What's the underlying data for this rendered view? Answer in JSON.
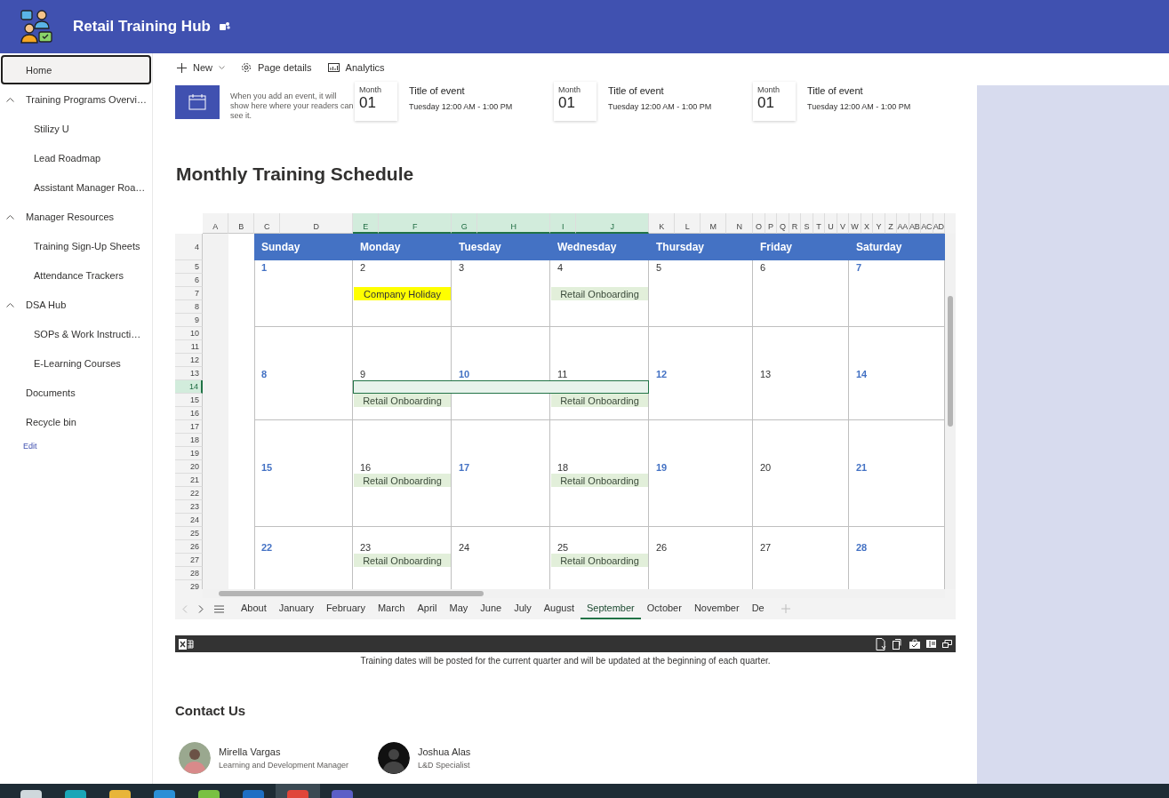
{
  "header": {
    "title": "Retail Training Hub"
  },
  "nav": {
    "items": [
      {
        "label": "Home",
        "selected": true
      },
      {
        "label": "Training Programs Overvi…",
        "selected": false,
        "expanded": true,
        "children": [
          {
            "label": "Stilizy U",
            "selected": false
          },
          {
            "label": "Lead Roadmap",
            "selected": false
          },
          {
            "label": "Assistant Manager Roa…",
            "selected": false
          }
        ]
      },
      {
        "label": "Manager Resources",
        "selected": false,
        "expanded": true,
        "children": [
          {
            "label": "Training Sign-Up Sheets",
            "selected": false
          },
          {
            "label": "Attendance Trackers",
            "selected": false
          }
        ]
      },
      {
        "label": "DSA Hub",
        "selected": false,
        "expanded": true,
        "children": [
          {
            "label": "SOPs & Work Instructi…",
            "selected": false
          },
          {
            "label": "E-Learning Courses",
            "selected": false
          }
        ]
      },
      {
        "label": "Documents",
        "selected": false
      },
      {
        "label": "Recycle bin",
        "selected": false
      }
    ],
    "edit_link": "Edit"
  },
  "command_bar": [
    {
      "label": "New",
      "dropdown": true
    },
    {
      "label": "Page details",
      "dropdown": false
    },
    {
      "label": "Analytics",
      "dropdown": false
    }
  ],
  "events": {
    "empty_text": "When you add an event, it will show here where your readers can see it.",
    "items": [
      {
        "month": "Month",
        "day": "01",
        "title": "Title of event",
        "time": "Tuesday 12:00 AM - 1:00 PM"
      },
      {
        "month": "Month",
        "day": "01",
        "title": "Title of event",
        "time": "Tuesday 12:00 AM - 1:00 PM"
      },
      {
        "month": "Month",
        "day": "01",
        "title": "Title of event",
        "time": "Tuesday 12:00 AM - 1:00 PM"
      }
    ]
  },
  "heading": "Monthly Training Schedule",
  "sheet": {
    "columns": [
      {
        "label": "A",
        "selected": false
      },
      {
        "label": "B",
        "selected": false
      },
      {
        "label": "C",
        "selected": false
      },
      {
        "label": "D",
        "selected": false
      },
      {
        "label": "E",
        "selected": true
      },
      {
        "label": "F",
        "selected": true
      },
      {
        "label": "G",
        "selected": true
      },
      {
        "label": "H",
        "selected": true
      },
      {
        "label": "I",
        "selected": true
      },
      {
        "label": "J",
        "selected": true
      },
      {
        "label": "K",
        "selected": false
      },
      {
        "label": "L",
        "selected": false
      },
      {
        "label": "M",
        "selected": false
      },
      {
        "label": "N",
        "selected": false
      },
      {
        "label": "O",
        "selected": false
      },
      {
        "label": "P",
        "selected": false
      },
      {
        "label": "Q",
        "selected": false
      },
      {
        "label": "R",
        "selected": false
      },
      {
        "label": "S",
        "selected": false
      },
      {
        "label": "T",
        "selected": false
      },
      {
        "label": "U",
        "selected": false
      },
      {
        "label": "V",
        "selected": false
      },
      {
        "label": "W",
        "selected": false
      },
      {
        "label": "X",
        "selected": false
      },
      {
        "label": "Y",
        "selected": false
      },
      {
        "label": "Z",
        "selected": false
      },
      {
        "label": "AA",
        "selected": false
      },
      {
        "label": "AB",
        "selected": false
      },
      {
        "label": "AC",
        "selected": false
      },
      {
        "label": "AD",
        "selected": false
      }
    ],
    "rows": [
      {
        "label": "4",
        "selected": false
      },
      {
        "label": "5",
        "selected": false
      },
      {
        "label": "6",
        "selected": false
      },
      {
        "label": "7",
        "selected": false
      },
      {
        "label": "8",
        "selected": false
      },
      {
        "label": "9",
        "selected": false
      },
      {
        "label": "10",
        "selected": false
      },
      {
        "label": "11",
        "selected": false
      },
      {
        "label": "12",
        "selected": false
      },
      {
        "label": "13",
        "selected": false
      },
      {
        "label": "14",
        "selected": true
      },
      {
        "label": "15",
        "selected": false
      },
      {
        "label": "16",
        "selected": false
      },
      {
        "label": "17",
        "selected": false
      },
      {
        "label": "18",
        "selected": false
      },
      {
        "label": "19",
        "selected": false
      },
      {
        "label": "20",
        "selected": false
      },
      {
        "label": "21",
        "selected": false
      },
      {
        "label": "22",
        "selected": false
      },
      {
        "label": "23",
        "selected": false
      },
      {
        "label": "24",
        "selected": false
      },
      {
        "label": "25",
        "selected": false
      },
      {
        "label": "26",
        "selected": false
      },
      {
        "label": "27",
        "selected": false
      },
      {
        "label": "28",
        "selected": false
      },
      {
        "label": "29",
        "selected": false
      }
    ],
    "weekdays": [
      "Sunday",
      "Monday",
      "Tuesday",
      "Wednesday",
      "Thursday",
      "Friday",
      "Saturday"
    ],
    "weeks": [
      {
        "days": [
          {
            "date": "1",
            "accent": true
          },
          {
            "date": "2",
            "accent": false,
            "events": [
              {
                "title": "Company Holiday",
                "kind": "holiday"
              }
            ]
          },
          {
            "date": "3",
            "accent": false
          },
          {
            "date": "4",
            "accent": false,
            "events": [
              {
                "title": "Retail Onboarding",
                "kind": "training"
              }
            ]
          },
          {
            "date": "5",
            "accent": false
          },
          {
            "date": "6",
            "accent": false
          },
          {
            "date": "7",
            "accent": true
          }
        ]
      },
      {
        "days": [
          {
            "date": "8",
            "accent": true
          },
          {
            "date": "9",
            "accent": false,
            "events": [
              {
                "title": "Retail Onboarding",
                "kind": "training"
              }
            ]
          },
          {
            "date": "10",
            "accent": true
          },
          {
            "date": "11",
            "accent": false,
            "events": [
              {
                "title": "Retail Onboarding",
                "kind": "training"
              }
            ]
          },
          {
            "date": "12",
            "accent": true
          },
          {
            "date": "13",
            "accent": false
          },
          {
            "date": "14",
            "accent": true
          }
        ]
      },
      {
        "days": [
          {
            "date": "15",
            "accent": true
          },
          {
            "date": "16",
            "accent": false,
            "events": [
              {
                "title": "Retail Onboarding",
                "kind": "training"
              }
            ]
          },
          {
            "date": "17",
            "accent": true
          },
          {
            "date": "18",
            "accent": false,
            "events": [
              {
                "title": "Retail Onboarding",
                "kind": "training"
              }
            ]
          },
          {
            "date": "19",
            "accent": true
          },
          {
            "date": "20",
            "accent": false
          },
          {
            "date": "21",
            "accent": true
          }
        ]
      },
      {
        "days": [
          {
            "date": "22",
            "accent": true
          },
          {
            "date": "23",
            "accent": false,
            "events": [
              {
                "title": "Retail Onboarding",
                "kind": "training"
              }
            ]
          },
          {
            "date": "24",
            "accent": false
          },
          {
            "date": "25",
            "accent": false,
            "events": [
              {
                "title": "Retail Onboarding",
                "kind": "training"
              }
            ]
          },
          {
            "date": "26",
            "accent": false
          },
          {
            "date": "27",
            "accent": false
          },
          {
            "date": "28",
            "accent": true
          }
        ]
      }
    ],
    "tabs": [
      {
        "label": "About",
        "selected": false
      },
      {
        "label": "January",
        "selected": false
      },
      {
        "label": "February",
        "selected": false
      },
      {
        "label": "March",
        "selected": false
      },
      {
        "label": "April",
        "selected": false
      },
      {
        "label": "May",
        "selected": false
      },
      {
        "label": "June",
        "selected": false
      },
      {
        "label": "July",
        "selected": false
      },
      {
        "label": "August",
        "selected": false
      },
      {
        "label": "September",
        "selected": true
      },
      {
        "label": "October",
        "selected": false
      },
      {
        "label": "November",
        "selected": false
      },
      {
        "label": "De",
        "selected": false
      }
    ]
  },
  "caption": "Training dates will be posted for the current quarter and will be updated at the beginning of each quarter.",
  "contacts": {
    "title": "Contact Us",
    "people": [
      {
        "name": "Mirella Vargas",
        "role": "Learning and Development Manager"
      },
      {
        "name": "Joshua Alas",
        "role": "L&D Specialist"
      }
    ]
  }
}
